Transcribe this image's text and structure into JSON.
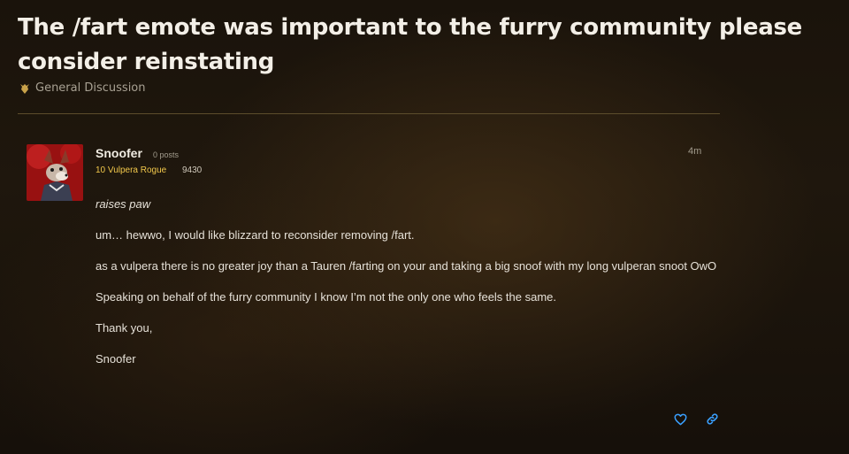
{
  "topic": {
    "title": "The /fart emote was important to the furry community please consider reinstating",
    "category": "General Discussion",
    "category_icon": "horde-crest-icon"
  },
  "post": {
    "author": "Snoofer",
    "post_count": "0 posts",
    "character": "10 Vulpera Rogue",
    "achievement_points": "9430",
    "time": "4m",
    "body": [
      "raises paw",
      "um… hewwo, I would like blizzard to reconsider removing /fart.",
      "as a vulpera there is no greater joy than a Tauren /farting on your and taking a big snoof with my long vulperan snoot OwO",
      "Speaking on behalf of the furry community I know I’m not the only one who feels the same.",
      "Thank you,",
      "Snoofer"
    ],
    "actions": [
      "heart-icon",
      "link-icon"
    ]
  },
  "colors": {
    "accent_blue": "#3aa0ff",
    "class_rogue_yellow": "#f2c84b",
    "divider": "#5c4d2c"
  }
}
